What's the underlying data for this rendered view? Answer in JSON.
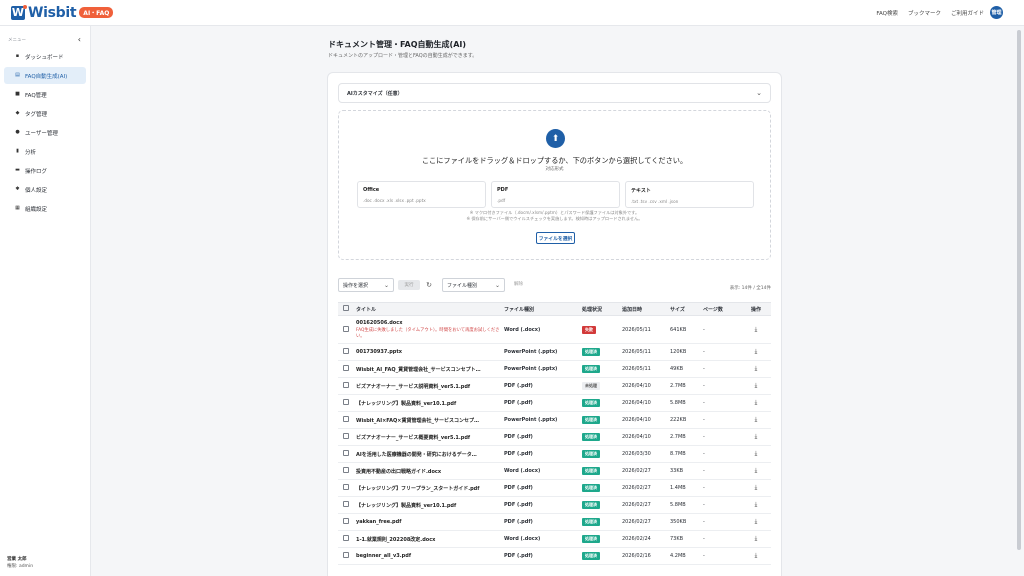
{
  "header": {
    "logo_mark": "W",
    "logo_text": "Wisbit",
    "logo_badge": "AI・FAQ",
    "nav": [
      "FAQ検索",
      "ブックマーク",
      "ご利用ガイド"
    ],
    "avatar_initials": "管理"
  },
  "sidebar": {
    "menu_label": "メニュー",
    "collapse_icon": "chevron-left-icon",
    "items": [
      {
        "label": "ダッシュボード",
        "icon": "dashboard-icon",
        "active": false
      },
      {
        "label": "FAQ自動生成(AI)",
        "icon": "document-icon",
        "active": true
      },
      {
        "label": "FAQ管理",
        "icon": "faq-icon",
        "active": false
      },
      {
        "label": "タグ管理",
        "icon": "tag-icon",
        "active": false
      },
      {
        "label": "ユーザー管理",
        "icon": "user-icon",
        "active": false
      },
      {
        "label": "分析",
        "icon": "chart-icon",
        "active": false
      },
      {
        "label": "操作ログ",
        "icon": "log-icon",
        "active": false
      },
      {
        "label": "個人設定",
        "icon": "gear-icon",
        "active": false
      },
      {
        "label": "組織設定",
        "icon": "building-icon",
        "active": false
      }
    ],
    "user_name": "営業 太郎",
    "user_role": "権限: admin"
  },
  "main": {
    "title": "ドキュメント管理・FAQ自動生成(AI)",
    "subtitle": "ドキュメントのアップロード・管理とFAQの自動生成ができます。",
    "customize_label": "AIカスタマイズ（任意）",
    "drop_main": "ここにファイルをドラッグ＆ドロップするか、下のボタンから選択してください。",
    "drop_sub": "対応形式",
    "formats": [
      {
        "name": "Office",
        "ext": ".doc .docx .xls .xlsx .ppt .pptx"
      },
      {
        "name": "PDF",
        "ext": ".pdf"
      },
      {
        "name": "テキスト",
        "ext": ".txt .tsv .csv .xml .json"
      }
    ],
    "note1": "※ マクロ付きファイル（.docm/.xlsm/.pptm）とパスワード保護ファイルは対象外です。",
    "note2": "※ 保存前にサーバー側でウイルスチェックを実施します。検知時はアップロードされません。",
    "select_file_label": "ファイルを選択",
    "operation_select": "操作を選択",
    "execute_label": "実行",
    "filetype_select": "ファイル種別",
    "reset_label": "解除",
    "count_text": "表示: 14件 / 全14件",
    "columns": [
      "タイトル",
      "ファイル種別",
      "処理状況",
      "追加日時",
      "サイズ",
      "ページ数",
      "操作"
    ],
    "rows": [
      {
        "title": "001620506.docx",
        "error": "FAQ生成に失敗しました（タイムアウト）。時間をおいて再度お試しください。",
        "type": "Word (.docx)",
        "status": "失敗",
        "status_kind": "fail",
        "date": "2026/05/11",
        "size": "641KB",
        "pages": "-"
      },
      {
        "title": "001730937.pptx",
        "type": "PowerPoint (.pptx)",
        "status": "処理済",
        "status_kind": "done",
        "date": "2026/05/11",
        "size": "120KB",
        "pages": "-"
      },
      {
        "title": "Wisbit_AI_FAQ_賃貸管理会社_サービスコンセプト…",
        "type": "PowerPoint (.pptx)",
        "status": "処理済",
        "status_kind": "done",
        "date": "2026/05/11",
        "size": "49KB",
        "pages": "-"
      },
      {
        "title": "ビズアナオーナー_サービス説明資料_ver5.1.pdf",
        "type": "PDF (.pdf)",
        "status": "未処理",
        "status_kind": "wait",
        "date": "2026/04/10",
        "size": "2.7MB",
        "pages": "-"
      },
      {
        "title": "【ナレッジリング】製品資料_ver10.1.pdf",
        "type": "PDF (.pdf)",
        "status": "処理済",
        "status_kind": "done",
        "date": "2026/04/10",
        "size": "5.8MB",
        "pages": "-"
      },
      {
        "title": "Wisbit_AI×FAQ×賃貸管理会社_サービスコンセプ…",
        "type": "PowerPoint (.pptx)",
        "status": "処理済",
        "status_kind": "done",
        "date": "2026/04/10",
        "size": "222KB",
        "pages": "-"
      },
      {
        "title": "ビズアナオーナー_サービス概要資料_ver5.1.pdf",
        "type": "PDF (.pdf)",
        "status": "処理済",
        "status_kind": "done",
        "date": "2026/04/10",
        "size": "2.7MB",
        "pages": "-"
      },
      {
        "title": "AIを活用した医療機器の開発・研究におけるデータ…",
        "type": "PDF (.pdf)",
        "status": "処理済",
        "status_kind": "done",
        "date": "2026/03/30",
        "size": "8.7MB",
        "pages": "-"
      },
      {
        "title": "投資用不動産の出口戦略ガイド.docx",
        "type": "Word (.docx)",
        "status": "処理済",
        "status_kind": "done",
        "date": "2026/02/27",
        "size": "33KB",
        "pages": "-"
      },
      {
        "title": "【ナレッジリング】フリープラン_スタートガイド.pdf",
        "type": "PDF (.pdf)",
        "status": "処理済",
        "status_kind": "done",
        "date": "2026/02/27",
        "size": "1.4MB",
        "pages": "-"
      },
      {
        "title": "【ナレッジリング】製品資料_ver10.1.pdf",
        "type": "PDF (.pdf)",
        "status": "処理済",
        "status_kind": "done",
        "date": "2026/02/27",
        "size": "5.8MB",
        "pages": "-"
      },
      {
        "title": "yakkan_free.pdf",
        "type": "PDF (.pdf)",
        "status": "処理済",
        "status_kind": "done",
        "date": "2026/02/27",
        "size": "350KB",
        "pages": "-"
      },
      {
        "title": "1-1.就業規則_202208改定.docx",
        "type": "Word (.docx)",
        "status": "処理済",
        "status_kind": "done",
        "date": "2026/02/24",
        "size": "73KB",
        "pages": "-"
      },
      {
        "title": "beginner_all_v3.pdf",
        "type": "PDF (.pdf)",
        "status": "処理済",
        "status_kind": "done",
        "date": "2026/02/16",
        "size": "4.2MB",
        "pages": "-"
      }
    ]
  },
  "colors": {
    "brand": "#1f5fa7",
    "accent": "#f0603a",
    "status_done": "#1ea88c",
    "status_fail": "#d23a3a"
  }
}
